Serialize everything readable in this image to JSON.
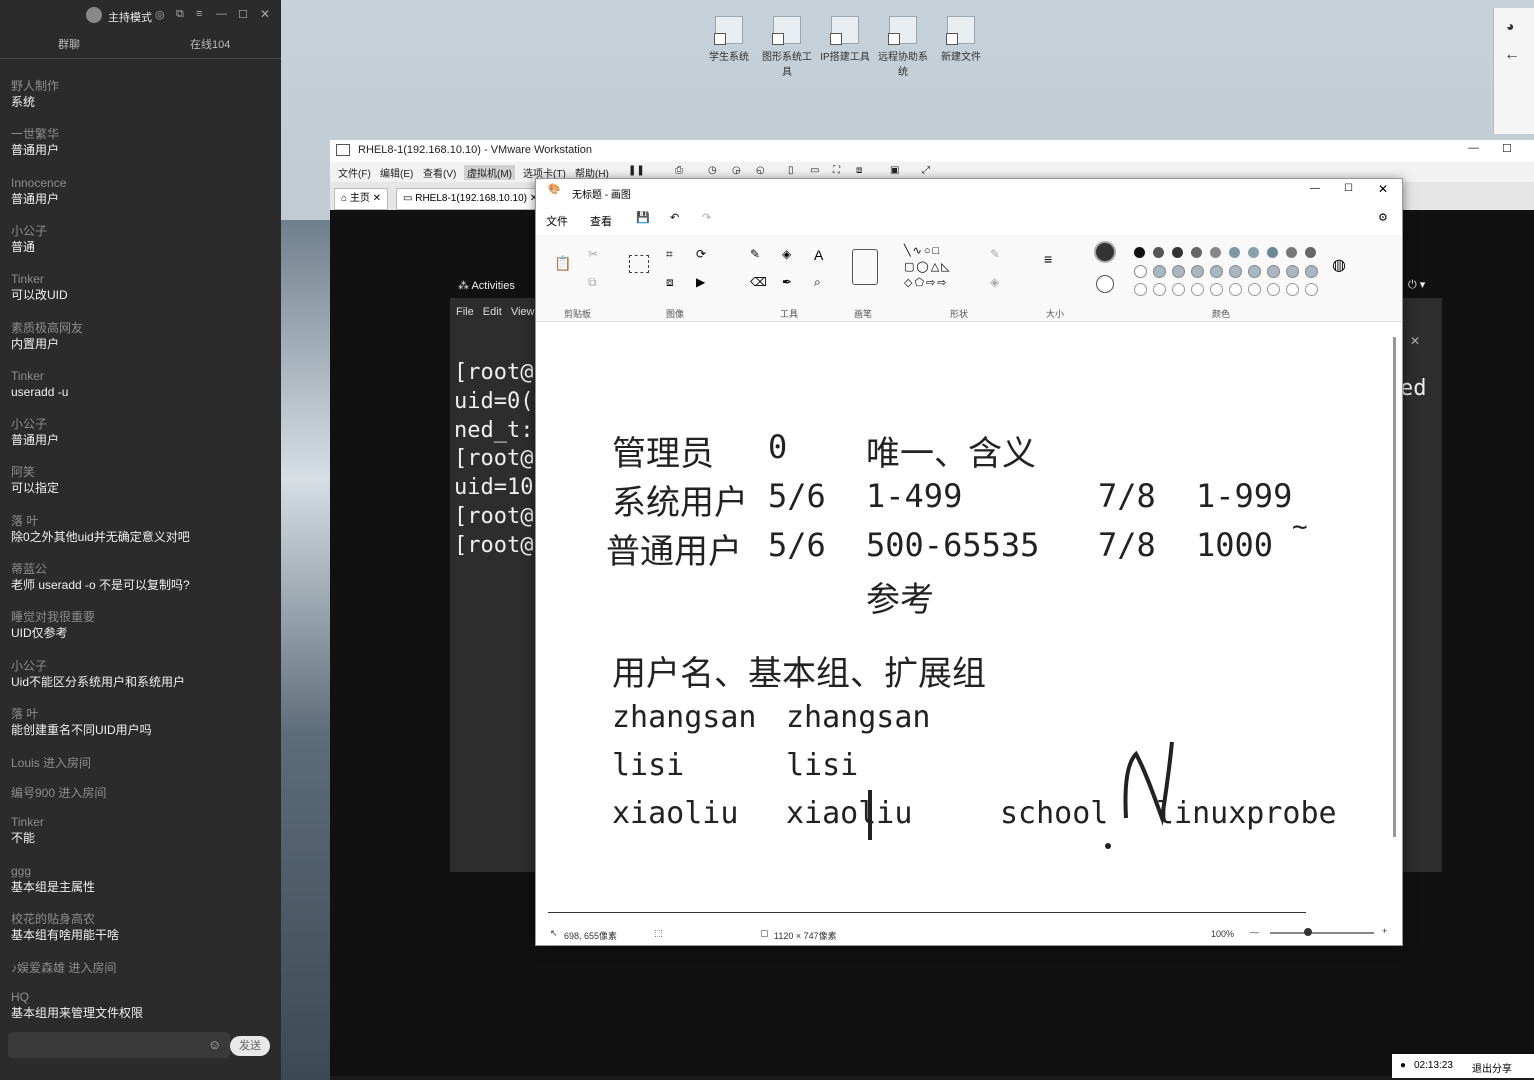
{
  "chat": {
    "title": "主持模式",
    "tabs": [
      "群聊",
      "在线104"
    ],
    "messages": [
      {
        "name": "野人制作",
        "text": "系统"
      },
      {
        "name": "一世繁华",
        "text": "普通用户"
      },
      {
        "name": "Innocence",
        "text": "普通用户"
      },
      {
        "name": "小公子",
        "text": "普通"
      },
      {
        "name": "Tinker",
        "text": "可以改UID"
      },
      {
        "name": "素质极高网友",
        "text": "内置用户"
      },
      {
        "name": "Tinker",
        "text": "useradd -u"
      },
      {
        "name": "小公子",
        "text": "普通用户"
      },
      {
        "name": "阿笑",
        "text": "可以指定"
      },
      {
        "name": "落  叶",
        "text": "除0之外其他uid并无确定意义对吧"
      },
      {
        "name": "蒂蓝公",
        "text": "老师  useradd  -o  不是可以复制吗?"
      },
      {
        "name": "睡觉对我很重要",
        "text": "UID仅参考"
      },
      {
        "name": "小公子",
        "text": "Uid不能区分系统用户和系统用户"
      },
      {
        "name": "落  叶",
        "text": "能创建重名不同UID用户吗"
      },
      {
        "system": "Louis 进入房间"
      },
      {
        "system": "编号900 进入房间"
      },
      {
        "name": "Tinker",
        "text": "不能"
      },
      {
        "name": "ggg",
        "text": "基本组是主属性"
      },
      {
        "name": "校花的贴身高农",
        "text": "基本组有啥用能干啥"
      },
      {
        "system": "♪娱爱森雄 进入房间"
      },
      {
        "name": "HQ",
        "text": "基本组用来管理文件权限"
      }
    ],
    "send_label": "发送"
  },
  "desktop_icons": [
    "学生系统",
    "图形系统工具",
    "IP搭建工具",
    "远程协助系统",
    "新建文件"
  ],
  "vmware": {
    "title": "RHEL8-1(192.168.10.10) - VMware Workstation",
    "menu": [
      "文件(F)",
      "编辑(E)",
      "查看(V)",
      "虚拟机(M)",
      "选项卡(T)",
      "帮助(H)"
    ],
    "tabs": [
      "主页",
      "RHEL8-1(192.168.10.10)"
    ],
    "activities": "Activities",
    "terminal_menu": [
      "File",
      "Edit",
      "View"
    ],
    "terminal_lines": [
      "[root@",
      "uid=0(",
      "ned_t:",
      "[root@",
      "uid=10",
      "[root@",
      "[root@"
    ],
    "terminal_right": "ed"
  },
  "paint": {
    "title": "无标题 - 画图",
    "menu": [
      "文件",
      "查看"
    ],
    "groups": [
      "剪贴板",
      "图像",
      "工具",
      "画笔",
      "形状",
      "大小",
      "颜色"
    ],
    "canvas": {
      "row1": [
        "管理员",
        "0",
        "唯一、含义"
      ],
      "row2": [
        "系统用户",
        "5/6",
        "1-499",
        "7/8",
        "1-999"
      ],
      "row3": [
        "普通用户",
        "5/6",
        "500-65535",
        "7/8",
        "1000",
        "~"
      ],
      "row4": "参考",
      "row5": "用户名、基本组、扩展组",
      "row6": [
        "zhangsan",
        "zhangsan"
      ],
      "row7": [
        "lisi",
        "lisi"
      ],
      "row8": [
        "xiaoliu",
        "xiaoliu",
        "school",
        "linuxprobe"
      ]
    },
    "status": {
      "cursor": "698, 655像素",
      "size": "1120 × 747像素",
      "zoom": "100%"
    }
  },
  "tray": {
    "time": "02:13:23",
    "exit_share": "退出分享"
  },
  "colors": {
    "chat_bg": "#2b2b2b",
    "desktop": "#c7d1d9",
    "terminal_bg": "#2d2d2d",
    "paint_bg": "#ffffff"
  }
}
